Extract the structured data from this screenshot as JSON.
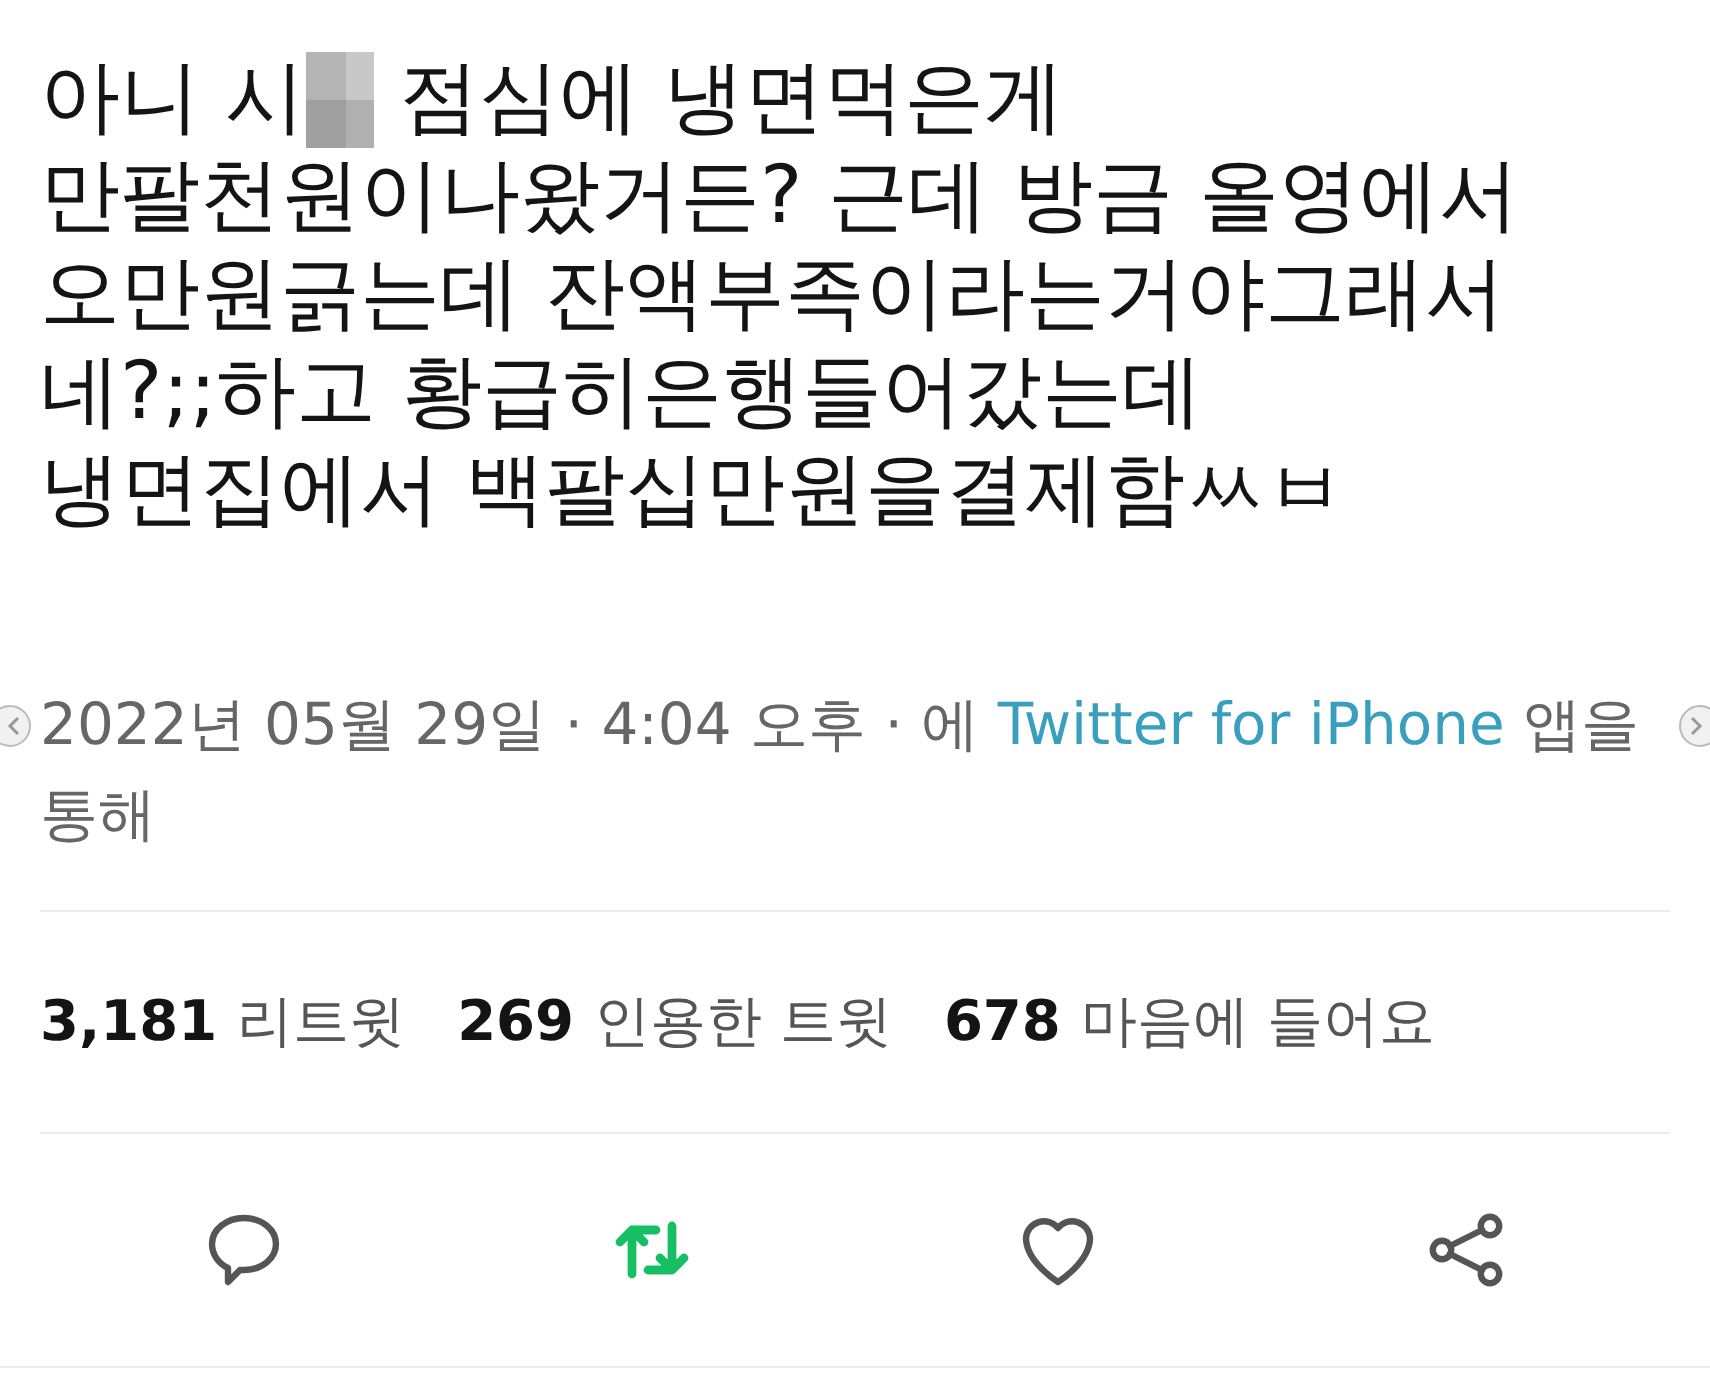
{
  "tweet": {
    "lines": [
      [
        {
          "kind": "text",
          "text": "아니 시"
        },
        {
          "kind": "censored"
        },
        {
          "kind": "text",
          "text": " 점심에 냉면먹은게"
        }
      ],
      [
        {
          "kind": "text",
          "text": "만팔천원이나왔거든? 근데 방금 올영에서"
        }
      ],
      [
        {
          "kind": "text",
          "text": "오만원긁는데 잔액부족이라는거야그래서"
        }
      ],
      [
        {
          "kind": "text",
          "text": "네?;;하고 황급히은행들어갔는데"
        }
      ],
      [
        {
          "kind": "text",
          "text": "냉면집에서 백팔십만원을결제함ㅆㅂ"
        }
      ]
    ],
    "meta": {
      "before": "2022년 05월 29일 · 4:04 오후 · 에 ",
      "source": "Twitter for iPhone",
      "after": " 앱을 통해"
    },
    "stats": [
      {
        "count": "3,181",
        "label": "리트윗"
      },
      {
        "count": "269",
        "label": "인용한 트윗"
      },
      {
        "count": "678",
        "label": "마음에 들어요"
      }
    ],
    "actions": [
      {
        "kind": "reply",
        "on": false
      },
      {
        "kind": "retweet",
        "on": true
      },
      {
        "kind": "like",
        "on": false
      },
      {
        "kind": "share",
        "on": false
      }
    ]
  },
  "carousel_arrows": [
    {
      "kind": "prev"
    },
    {
      "kind": "next"
    }
  ]
}
